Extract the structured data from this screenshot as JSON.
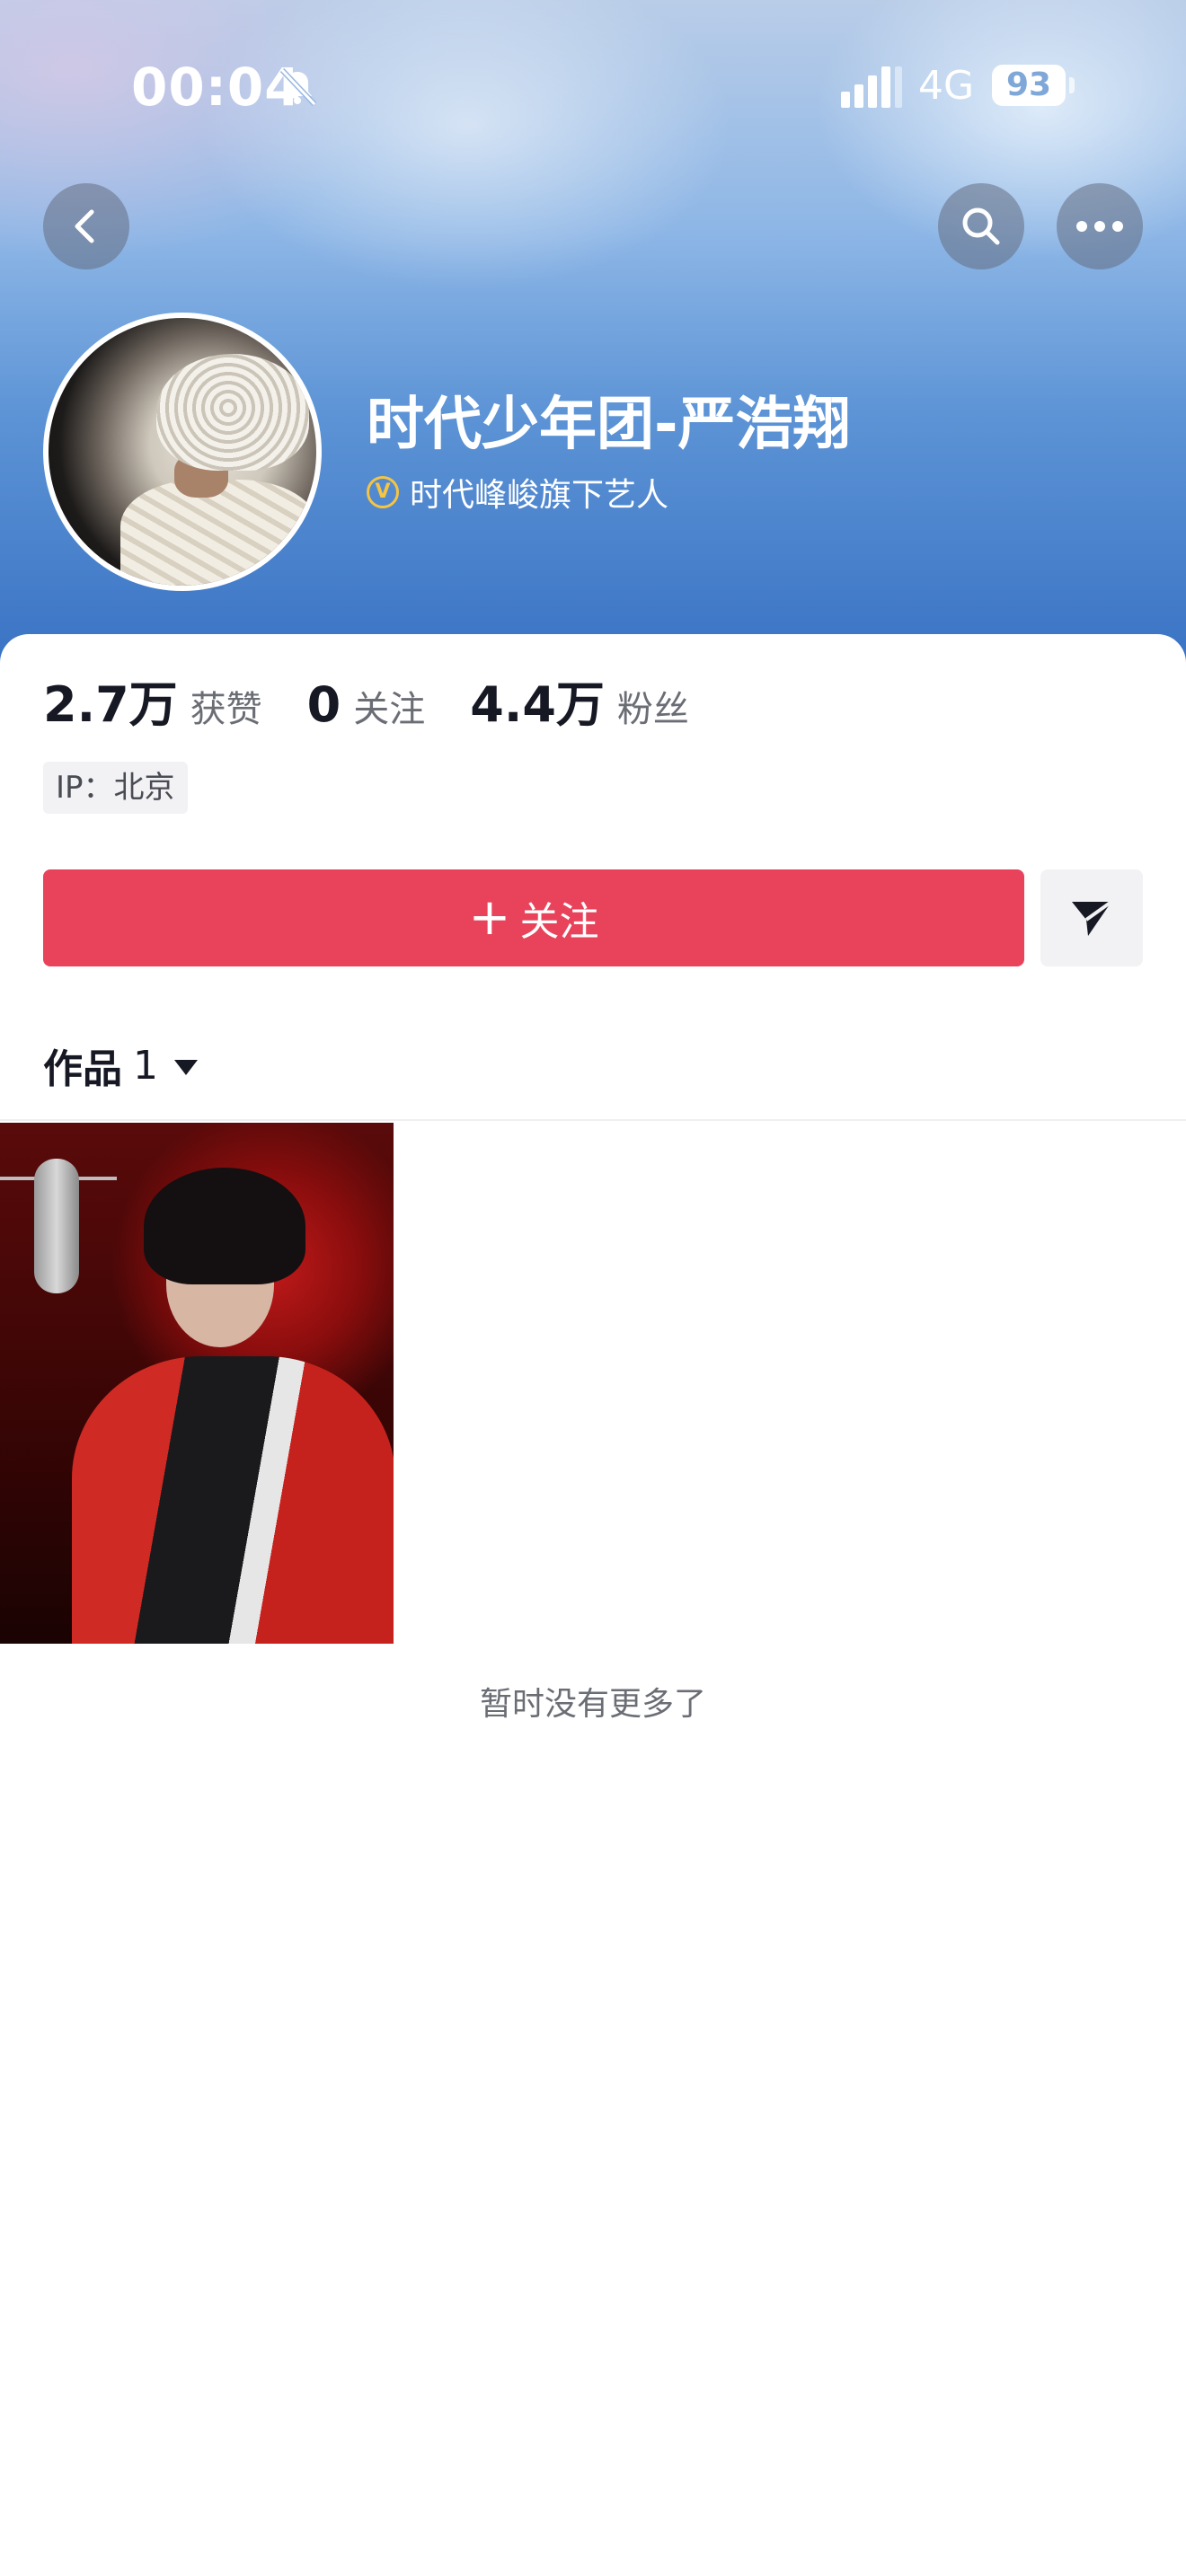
{
  "status_bar": {
    "time": "00:04",
    "network": "4G",
    "battery": "93"
  },
  "profile": {
    "name": "时代少年团-严浩翔",
    "verification": "时代峰峻旗下艺人",
    "verify_badge": "V"
  },
  "stats": {
    "likes_count": "2.7万",
    "likes_label": "获赞",
    "following_count": "0",
    "following_label": "关注",
    "followers_count": "4.4万",
    "followers_label": "粉丝"
  },
  "ip_location": "IP：北京",
  "actions": {
    "follow_plus": "+",
    "follow_label": "关注"
  },
  "works_tab": {
    "label": "作品",
    "count": "1"
  },
  "end_message": "暂时没有更多了",
  "colors": {
    "follow_button": "#e8435a",
    "verify_badge": "#f5c443",
    "header_gradient_bottom": "#3a73c4"
  }
}
